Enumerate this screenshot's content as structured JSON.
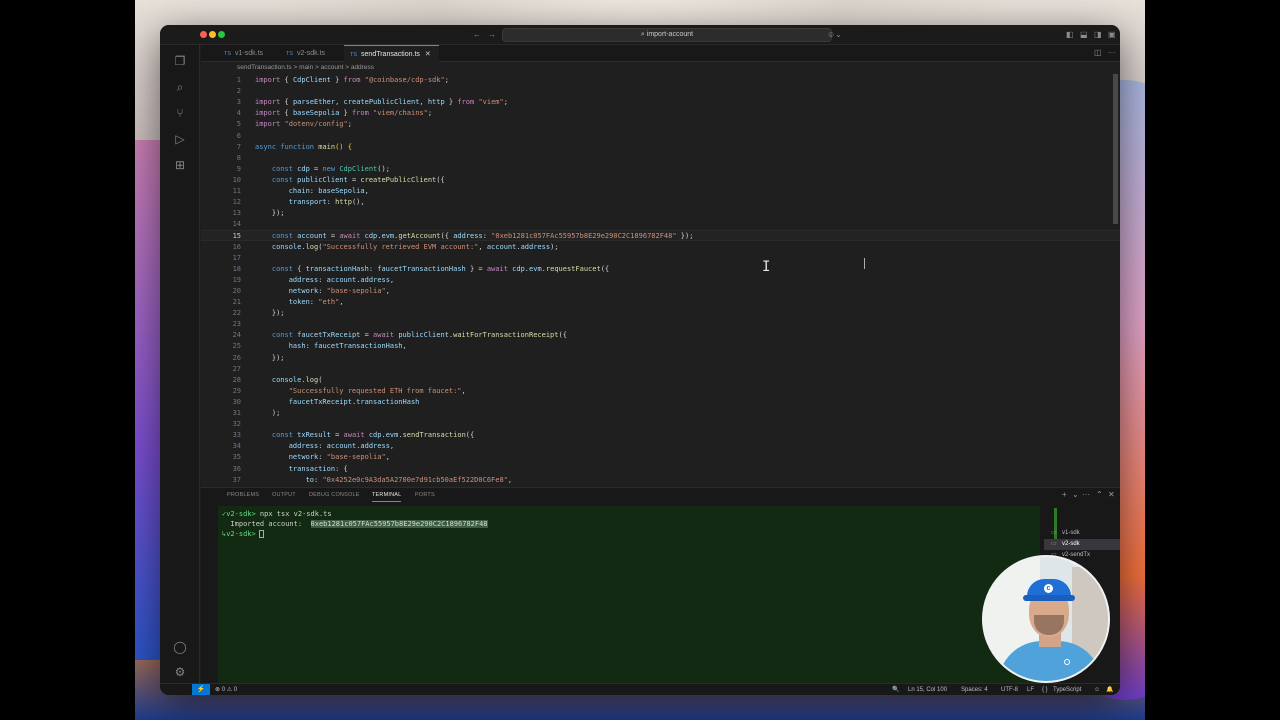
{
  "window": {
    "command_center": "import-account"
  },
  "tabs": [
    {
      "label": "v1-sdk.ts",
      "ts": "TS",
      "active": false
    },
    {
      "label": "v2-sdk.ts",
      "ts": "TS",
      "active": false
    },
    {
      "label": "sendTransaction.ts",
      "ts": "TS",
      "active": true
    }
  ],
  "breadcrumb": {
    "file": "sendTransaction.ts",
    "sep1": ">",
    "fn": "main",
    "sep2": ">",
    "var": "account",
    "sep3": ">",
    "prop": "address"
  },
  "editor": {
    "cursor_line": 15,
    "lines": [
      {
        "n": "1",
        "html": "<span class='kc'>import</span> <span class='p'>{ </span><span class='v'>CdpClient</span><span class='p'> } </span><span class='kc'>from</span> <span class='s'>\"@coinbase/cdp-sdk\"</span><span class='p'>;</span>"
      },
      {
        "n": "2",
        "html": ""
      },
      {
        "n": "3",
        "html": "<span class='kc'>import</span> <span class='p'>{ </span><span class='v'>parseEther</span><span class='p'>, </span><span class='v'>createPublicClient</span><span class='p'>, </span><span class='v'>http</span><span class='p'> } </span><span class='kc'>from</span> <span class='s'>\"viem\"</span><span class='p'>;</span>"
      },
      {
        "n": "4",
        "html": "<span class='kc'>import</span> <span class='p'>{ </span><span class='v'>baseSepolia</span><span class='p'> } </span><span class='kc'>from</span> <span class='s'>\"viem/chains\"</span><span class='p'>;</span>"
      },
      {
        "n": "5",
        "html": "<span class='kc'>import</span> <span class='s'>\"dotenv/config\"</span><span class='p'>;</span>"
      },
      {
        "n": "6",
        "html": ""
      },
      {
        "n": "7",
        "html": "<span class='k'>async</span> <span class='k'>function</span> <span class='f'>main</span><span class='b'>()</span><span class='p'> </span><span class='b'>{</span>"
      },
      {
        "n": "8",
        "html": ""
      },
      {
        "n": "9",
        "html": "    <span class='k'>const</span> <span class='v'>cdp</span><span class='p'> = </span><span class='k'>new</span> <span class='t'>CdpClient</span><span class='p'>();</span>"
      },
      {
        "n": "10",
        "html": "    <span class='k'>const</span> <span class='v'>publicClient</span><span class='p'> = </span><span class='f'>createPublicClient</span><span class='p'>({</span>"
      },
      {
        "n": "11",
        "html": "        <span class='v'>chain</span><span class='p'>: </span><span class='v'>baseSepolia</span><span class='p'>,</span>"
      },
      {
        "n": "12",
        "html": "        <span class='v'>transport</span><span class='p'>: </span><span class='f'>http</span><span class='p'>(),</span>"
      },
      {
        "n": "13",
        "html": "    <span class='p'>});</span>"
      },
      {
        "n": "14",
        "html": ""
      },
      {
        "n": "15",
        "html": "    <span class='k'>const</span> <span class='v'>account</span><span class='p'> = </span><span class='kc'>await</span> <span class='v'>cdp</span><span class='p'>.</span><span class='v'>evm</span><span class='p'>.</span><span class='f'>getAccount</span><span class='p'>({ </span><span class='v'>address</span><span class='p'>: </span><span class='s'>\"0xeb1281c057FAc55957b8E29e290C2C1896782F48\"</span><span class='p'> });</span>"
      },
      {
        "n": "16",
        "html": "    <span class='v'>console</span><span class='p'>.</span><span class='f'>log</span><span class='p'>(</span><span class='s'>\"Successfully retrieved EVM account:\"</span><span class='p'>, </span><span class='v'>account</span><span class='p'>.</span><span class='v'>address</span><span class='p'>);</span>"
      },
      {
        "n": "17",
        "html": ""
      },
      {
        "n": "18",
        "html": "    <span class='k'>const</span> <span class='p'>{ </span><span class='v'>transactionHash</span><span class='p'>: </span><span class='v'>faucetTransactionHash</span><span class='p'> } = </span><span class='kc'>await</span> <span class='v'>cdp</span><span class='p'>.</span><span class='v'>evm</span><span class='p'>.</span><span class='f'>requestFaucet</span><span class='p'>({</span>"
      },
      {
        "n": "19",
        "html": "        <span class='v'>address</span><span class='p'>: </span><span class='v'>account</span><span class='p'>.</span><span class='v'>address</span><span class='p'>,</span>"
      },
      {
        "n": "20",
        "html": "        <span class='v'>network</span><span class='p'>: </span><span class='s'>\"base-sepolia\"</span><span class='p'>,</span>"
      },
      {
        "n": "21",
        "html": "        <span class='v'>token</span><span class='p'>: </span><span class='s'>\"eth\"</span><span class='p'>,</span>"
      },
      {
        "n": "22",
        "html": "    <span class='p'>});</span>"
      },
      {
        "n": "23",
        "html": ""
      },
      {
        "n": "24",
        "html": "    <span class='k'>const</span> <span class='v'>faucetTxReceipt</span><span class='p'> = </span><span class='kc'>await</span> <span class='v'>publicClient</span><span class='p'>.</span><span class='f'>waitForTransactionReceipt</span><span class='p'>({</span>"
      },
      {
        "n": "25",
        "html": "        <span class='v'>hash</span><span class='p'>: </span><span class='v'>faucetTransactionHash</span><span class='p'>,</span>"
      },
      {
        "n": "26",
        "html": "    <span class='p'>});</span>"
      },
      {
        "n": "27",
        "html": ""
      },
      {
        "n": "28",
        "html": "    <span class='v'>console</span><span class='p'>.</span><span class='f'>log</span><span class='p'>(</span>"
      },
      {
        "n": "29",
        "html": "        <span class='s'>\"Successfully requested ETH from faucet:\"</span><span class='p'>,</span>"
      },
      {
        "n": "30",
        "html": "        <span class='v'>faucetTxReceipt</span><span class='p'>.</span><span class='v'>transactionHash</span>"
      },
      {
        "n": "31",
        "html": "    <span class='p'>);</span>"
      },
      {
        "n": "32",
        "html": ""
      },
      {
        "n": "33",
        "html": "    <span class='k'>const</span> <span class='v'>txResult</span><span class='p'> = </span><span class='kc'>await</span> <span class='v'>cdp</span><span class='p'>.</span><span class='v'>evm</span><span class='p'>.</span><span class='f'>sendTransaction</span><span class='p'>({</span>"
      },
      {
        "n": "34",
        "html": "        <span class='v'>address</span><span class='p'>: </span><span class='v'>account</span><span class='p'>.</span><span class='v'>address</span><span class='p'>,</span>"
      },
      {
        "n": "35",
        "html": "        <span class='v'>network</span><span class='p'>: </span><span class='s'>\"base-sepolia\"</span><span class='p'>,</span>"
      },
      {
        "n": "36",
        "html": "        <span class='v'>transaction</span><span class='p'>: {</span>"
      },
      {
        "n": "37",
        "html": "            <span class='v'>to</span><span class='p'>: </span><span class='s'>\"0x4252e0c9A3da5A2700e7d91cb50aEf522D0C6Fe8\"</span><span class='p'>,</span>"
      }
    ]
  },
  "panel": {
    "tabs": [
      {
        "label": "PROBLEMS",
        "active": false
      },
      {
        "label": "OUTPUT",
        "active": false
      },
      {
        "label": "DEBUG CONSOLE",
        "active": false
      },
      {
        "label": "TERMINAL",
        "active": true
      },
      {
        "label": "PORTS",
        "active": false
      }
    ],
    "icons": {
      "add": "+",
      "dropdown": "⌄",
      "more": "···",
      "maximize": "⌃",
      "close": "✕"
    }
  },
  "terminal": {
    "line1_prompt": "✓v2-sdk>",
    "line1_cmd": " npx tsx v2-sdk.ts",
    "line2_label": "  Imported account:  ",
    "line2_value": "0xeb1281c057FAc55957b8E29e290C2C1896782F48",
    "line3_prompt": "↳v2-sdk>",
    "terminals": [
      {
        "label": "v1-sdk",
        "selected": false
      },
      {
        "label": "v2-sdk",
        "selected": true
      },
      {
        "label": "v2-sendTx",
        "selected": false
      }
    ]
  },
  "status": {
    "remote": "⚡",
    "problems": "⊗ 0 ⚠ 0",
    "position": "Ln 15, Col 100",
    "spaces": "Spaces: 4",
    "encoding": "UTF-8",
    "eol": "LF",
    "language_braces": "{ }",
    "language": "TypeScript",
    "bell": "🔔"
  },
  "colors": {
    "accent": "#3794ff",
    "terminal_bg": "#122a12",
    "status_remote": "#0078d4"
  }
}
